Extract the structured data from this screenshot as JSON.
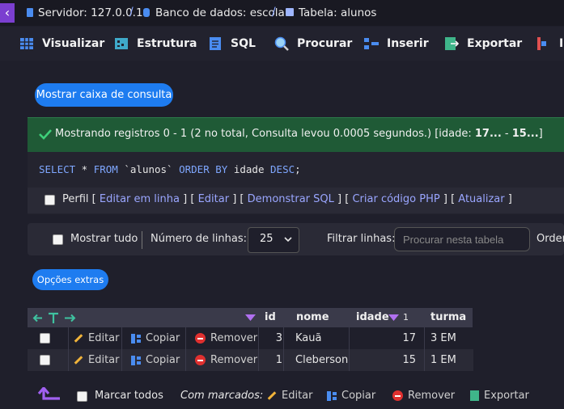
{
  "breadcrumb": {
    "server": "Servidor: 127.0.0.1",
    "database": "Banco de dados: escola",
    "table": "Tabela: alunos",
    "separator": "/"
  },
  "tabs": [
    "Visualizar",
    "Estrutura",
    "SQL",
    "Procurar",
    "Inserir",
    "Exportar",
    "Im"
  ],
  "query_box_button": "Mostrar caixa de consulta",
  "success": {
    "text_prefix": "Mostrando registros 0 - 1 (2 no total, Consulta levou 0.0005 segundos.) [idade: ",
    "range_from": "17...",
    "range_sep": " - ",
    "range_to": "15...",
    "text_suffix": "]"
  },
  "sql": {
    "select": "SELECT",
    "star": " * ",
    "from": "FROM",
    "table": " `alunos` ",
    "order_by": "ORDER BY",
    "column": " idade ",
    "desc": "DESC",
    "end": ";"
  },
  "query_links": {
    "perfil": "Perfil",
    "edit_inline": "Editar em linha",
    "edit": "Editar",
    "explain": "Demonstrar SQL",
    "php": "Criar código PHP",
    "refresh": "Atualizar",
    "open_bracket": "[",
    "close_bracket": "]"
  },
  "nav": {
    "show_all": "Mostrar tudo",
    "rows_label": "Número de linhas:",
    "rows_value": "25",
    "filter_label": "Filtrar linhas:",
    "filter_placeholder": "Procurar nesta tabela",
    "order_label": "Order"
  },
  "extra_options": "Opções extras",
  "table": {
    "columns": [
      "id",
      "nome",
      "idade",
      "turma"
    ],
    "sort_index": "1",
    "rows": [
      {
        "id": "3",
        "nome": "Kauã",
        "idade": "17",
        "turma": "3 EM"
      },
      {
        "id": "1",
        "nome": "Cleberson",
        "idade": "15",
        "turma": "1 EM"
      }
    ],
    "actions": {
      "edit": "Editar",
      "copy": "Copiar",
      "delete": "Remover"
    }
  },
  "footer": {
    "check_all": "Marcar todos",
    "with_selected": "Com marcados:",
    "edit": "Editar",
    "copy": "Copiar",
    "delete": "Remover",
    "export": "Exportar"
  },
  "colors": {
    "accent": "#1e7cf0",
    "success_bg": "#1f5a36",
    "purple": "#7b3fd0",
    "sql_keyword": "#7fa7ff"
  }
}
